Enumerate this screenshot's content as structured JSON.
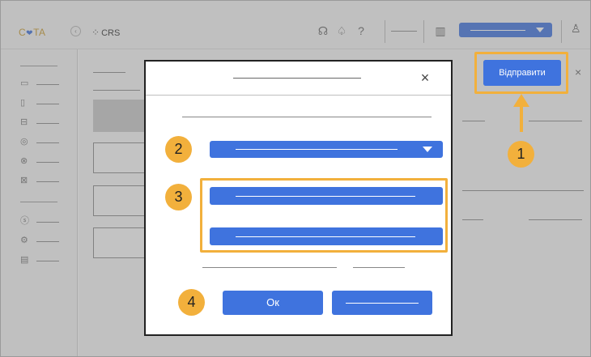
{
  "app": {
    "logo_text_left": "C",
    "logo_text_right": "TA",
    "collapse_icon": "‹",
    "module_label": "CRS",
    "module_icon": "grid-icon"
  },
  "toolbar": {
    "icons": [
      "headset-icon",
      "bell-icon",
      "help-icon",
      "building-icon",
      "user-icon"
    ]
  },
  "main": {
    "send_button_label": "Відправити",
    "close_glyph": "×"
  },
  "dialog": {
    "close_glyph": "×",
    "ok_label": "Ок"
  },
  "callouts": [
    "1",
    "2",
    "3",
    "4"
  ],
  "colors": {
    "accent": "#3f73de",
    "highlight": "#f2b03c"
  }
}
